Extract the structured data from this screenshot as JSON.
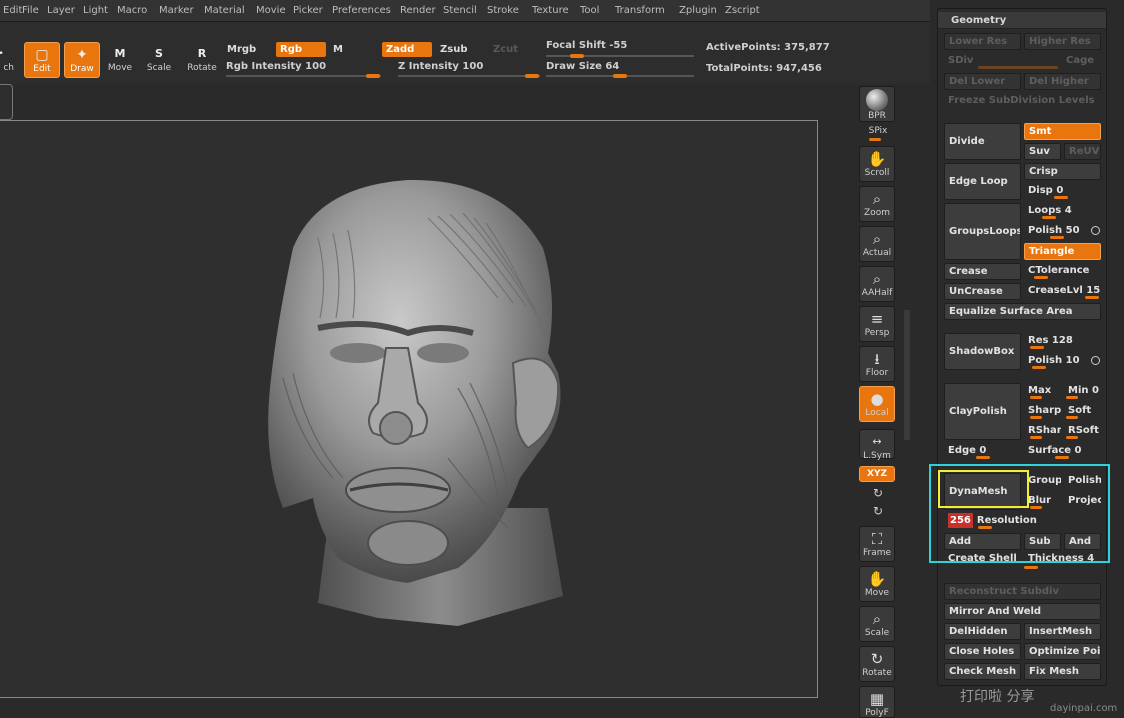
{
  "menu": [
    "Edit",
    "File",
    "Layer",
    "Light",
    "Macro",
    "Marker",
    "Material",
    "Movie",
    "Picker",
    "Preferences",
    "Render",
    "Stencil",
    "Stroke",
    "Texture",
    "Tool",
    "Transform",
    "Zplugin",
    "Zscript"
  ],
  "toolbar": {
    "sketch_label": "ch",
    "edit_label": "Edit",
    "draw_label": "Draw",
    "move_label": "Move",
    "scale_label": "Scale",
    "rotate_label": "Rotate",
    "move_letter": "M",
    "scale_letter": "S",
    "rotate_letter": "R",
    "mrgb": "Mrgb",
    "rgb": "Rgb",
    "m": "M",
    "zadd": "Zadd",
    "zsub": "Zsub",
    "zcut": "Zcut",
    "rgb_intensity": "Rgb Intensity 100",
    "z_intensity": "Z Intensity 100",
    "focal_shift": "Focal Shift -55",
    "draw_size": "Draw Size 64",
    "active_points": "ActivePoints: 375,877",
    "total_points": "TotalPoints: 947,456"
  },
  "shelf": {
    "bpr": "BPR",
    "spix": "SPix",
    "scroll": "Scroll",
    "zoom": "Zoom",
    "actual": "Actual",
    "aahalf": "AAHalf",
    "persp": "Persp",
    "floor": "Floor",
    "local": "Local",
    "lsym": "L.Sym",
    "xyz": "XYZ",
    "frame": "Frame",
    "move": "Move",
    "scale": "Scale",
    "rotate": "Rotate",
    "polyf": "PolyF"
  },
  "geometry": {
    "title": "Geometry",
    "lower_res": "Lower Res",
    "higher_res": "Higher Res",
    "sdiv": "SDiv",
    "cage": "Cage",
    "del_lower": "Del Lower",
    "del_higher": "Del Higher",
    "freeze_subdivision": "Freeze SubDivision Levels",
    "divide": "Divide",
    "smt": "Smt",
    "suv": "Suv",
    "reuv": "ReUV",
    "edge_loop": "Edge Loop",
    "crisp": "Crisp",
    "disp": "Disp 0",
    "groups_loops": "GroupsLoops",
    "loops": "Loops 4",
    "polish": "Polish 50",
    "triangle": "Triangle",
    "crease": "Crease",
    "ctolerance": "CTolerance",
    "uncrease": "UnCrease",
    "creaselvl": "CreaseLvl 15",
    "equalize": "Equalize Surface Area",
    "shadowbox": "ShadowBox",
    "res": "Res 128",
    "polish_10": "Polish 10",
    "claypolish": "ClayPolish",
    "max": "Max",
    "min": "Min 0",
    "sharp": "Sharp",
    "soft": "Soft",
    "rshar": "RShar",
    "rsoft": "RSoft",
    "edge": "Edge 0",
    "surface": "Surface 0",
    "dynamesh": "DynaMesh",
    "group": "Group",
    "polish_dm": "Polish",
    "blur": "Blur",
    "project": "Projec",
    "resolution_value": "256",
    "resolution_label": "Resolution",
    "add": "Add",
    "sub": "Sub",
    "and": "And",
    "create_shell": "Create Shell",
    "thickness": "Thickness 4",
    "reconstruct_subdiv": "Reconstruct Subdiv",
    "mirror_weld": "Mirror And Weld",
    "delhidden": "DelHidden",
    "insertmesh": "InsertMesh",
    "close_holes": "Close Holes",
    "optimize_points": "Optimize Poi",
    "check_mesh": "Check Mesh",
    "fix_mesh": "Fix Mesh"
  },
  "watermark": {
    "cn": "打印啦 分享",
    "url": "dayinpai.com"
  },
  "colors": {
    "accent": "#e8750e",
    "highlight_yellow": "#f3ee35",
    "highlight_cyan": "#2fd2d8"
  }
}
